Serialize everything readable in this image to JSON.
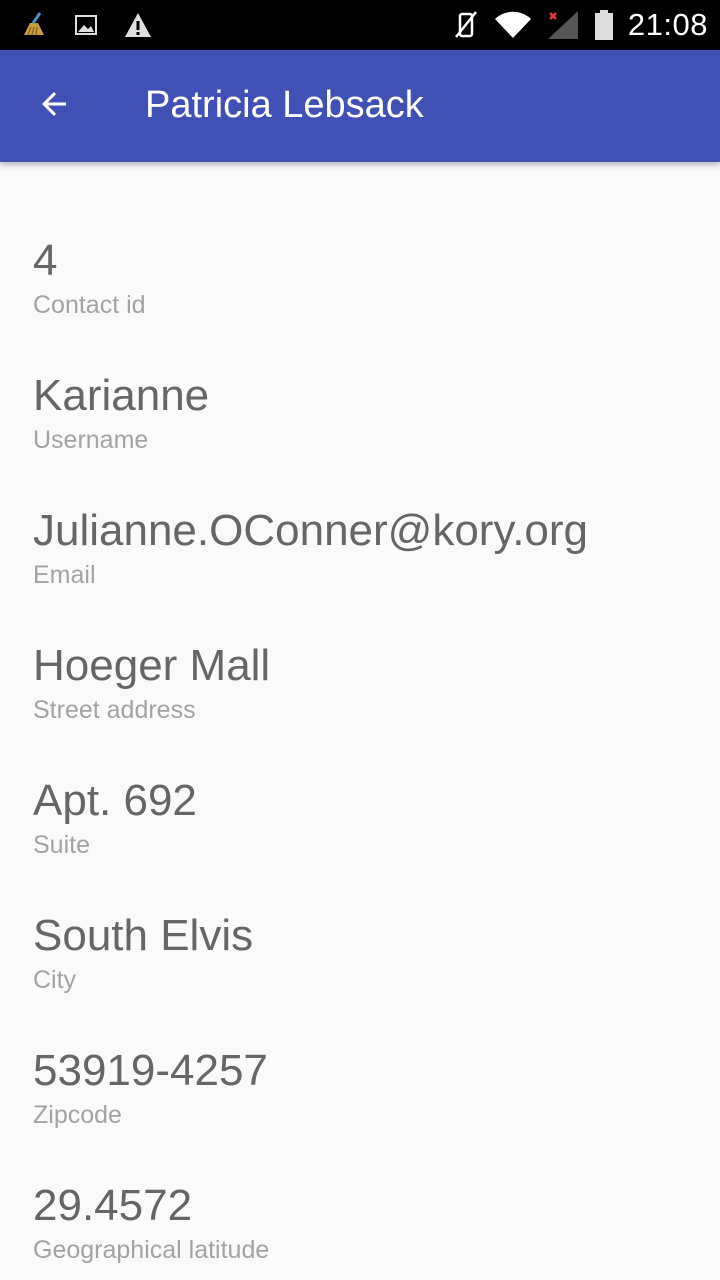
{
  "status_bar": {
    "time": "21:08",
    "left_icons": [
      "cleaner-icon",
      "image-icon",
      "warning-icon"
    ],
    "right_icons": [
      "vibrate-off-icon",
      "wifi-icon",
      "signal-icon",
      "battery-icon"
    ]
  },
  "app_bar": {
    "title": "Patricia Lebsack",
    "color": "#3f51b5"
  },
  "fields": [
    {
      "value": "4",
      "label": "Contact id"
    },
    {
      "value": "Karianne",
      "label": "Username"
    },
    {
      "value": "Julianne.OConner@kory.org",
      "label": "Email"
    },
    {
      "value": "Hoeger Mall",
      "label": "Street address"
    },
    {
      "value": "Apt. 692",
      "label": "Suite"
    },
    {
      "value": "South Elvis",
      "label": "City"
    },
    {
      "value": "53919-4257",
      "label": "Zipcode"
    },
    {
      "value": "29.4572",
      "label": "Geographical latitude"
    }
  ]
}
